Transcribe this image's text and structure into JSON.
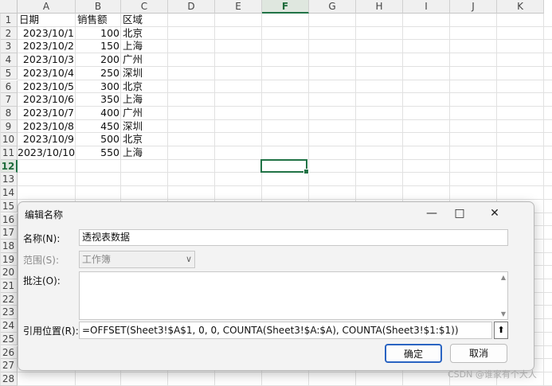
{
  "sheet": {
    "columns": [
      "A",
      "B",
      "C",
      "D",
      "E",
      "F",
      "G",
      "H",
      "I",
      "J",
      "K"
    ],
    "active_column": "F",
    "rows": [
      "1",
      "2",
      "3",
      "4",
      "5",
      "6",
      "7",
      "8",
      "9",
      "10",
      "11",
      "12",
      "13",
      "14",
      "15",
      "16",
      "17",
      "18",
      "19",
      "20",
      "21",
      "22",
      "23",
      "24",
      "25",
      "26",
      "27",
      "28"
    ],
    "active_row": "12",
    "header": [
      "日期",
      "销售额",
      "区域"
    ],
    "data": [
      [
        "2023/10/1",
        "100",
        "北京"
      ],
      [
        "2023/10/2",
        "150",
        "上海"
      ],
      [
        "2023/10/3",
        "200",
        "广州"
      ],
      [
        "2023/10/4",
        "250",
        "深圳"
      ],
      [
        "2023/10/5",
        "300",
        "北京"
      ],
      [
        "2023/10/6",
        "350",
        "上海"
      ],
      [
        "2023/10/7",
        "400",
        "广州"
      ],
      [
        "2023/10/8",
        "450",
        "深圳"
      ],
      [
        "2023/10/9",
        "500",
        "北京"
      ],
      [
        "2023/10/10",
        "550",
        "上海"
      ]
    ]
  },
  "dialog": {
    "title": "编辑名称",
    "minimize_icon": "minimize-icon",
    "maximize_icon": "maximize-icon",
    "close_icon": "close-icon",
    "name_label": "名称(N):",
    "name_value": "透视表数据",
    "scope_label": "范围(S):",
    "scope_value": "工作簿",
    "comment_label": "批注(O):",
    "comment_value": "",
    "ref_label": "引用位置(R):",
    "ref_value": "=OFFSET(Sheet3!$A$1, 0, 0, COUNTA(Sheet3!$A:$A), COUNTA(Sheet3!$1:$1))",
    "ok_label": "确定",
    "cancel_label": "取消"
  },
  "watermark": "CSDN @谁家有个大人"
}
